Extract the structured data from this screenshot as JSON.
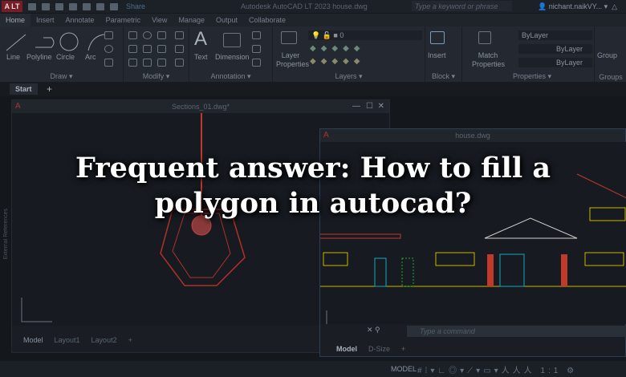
{
  "app": {
    "logo": "A LT",
    "title": "Autodesk AutoCAD LT 2023   house.dwg",
    "share": "Share",
    "search_placeholder": "Type a keyword or phrase",
    "user": "nichant.naikVY..."
  },
  "ribbon_tabs": [
    "Home",
    "Insert",
    "Annotate",
    "Parametric",
    "View",
    "Manage",
    "Output",
    "Collaborate"
  ],
  "panels": {
    "draw": {
      "title": "Draw",
      "tools": [
        "Line",
        "Polyline",
        "Circle",
        "Arc"
      ]
    },
    "modify": {
      "title": "Modify"
    },
    "annotation": {
      "title": "Annotation",
      "tools": [
        "Text",
        "Dimension"
      ]
    },
    "layers": {
      "title": "Layers",
      "tool": "Layer Properties",
      "layer": "0"
    },
    "block": {
      "title": "Block",
      "tool": "Insert"
    },
    "properties": {
      "title": "Properties",
      "tool": "Match Properties",
      "color": "ByLayer",
      "lineweight": "ByLayer",
      "linetype": "ByLayer"
    },
    "groups": {
      "title": "Groups",
      "tool": "Group"
    }
  },
  "file_tabs": {
    "start": "Start",
    "add": "+"
  },
  "window1": {
    "title": "Sections_01.dwg*",
    "layout_tabs": [
      "Model",
      "Layout1",
      "Layout2",
      "+"
    ],
    "side_label": "External References"
  },
  "window2": {
    "title": "house.dwg",
    "command_placeholder": "Type a command",
    "layout_tabs": [
      "Model",
      "D-Size",
      "+"
    ]
  },
  "status": {
    "model": "MODEL",
    "scale": "1:1"
  },
  "headline": "Frequent answer: How to fill a polygon in autocad?",
  "colors": {
    "accent": "#3a6ea5",
    "drawing_red": "#c0392b",
    "drawing_yellow": "#c8b400"
  }
}
